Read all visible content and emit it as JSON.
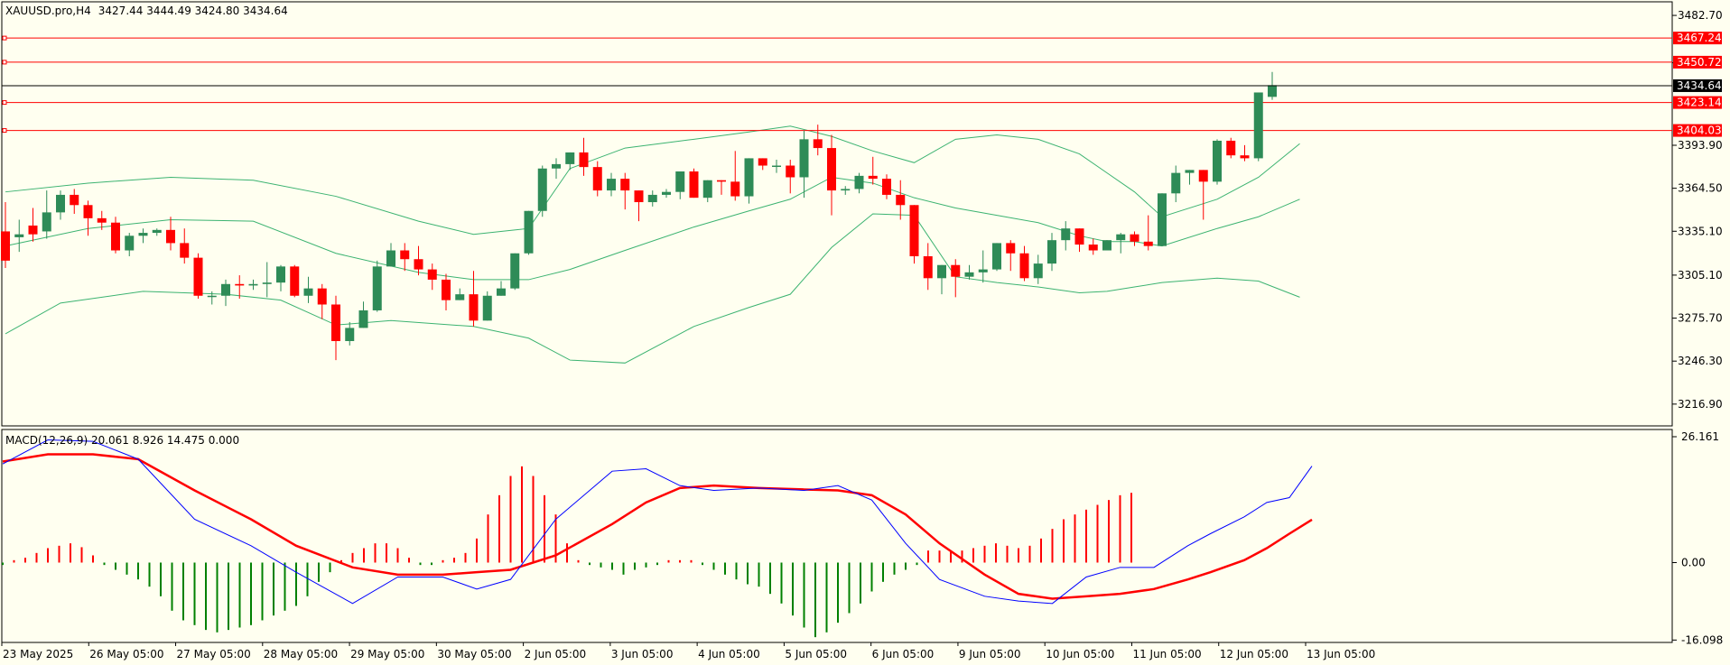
{
  "colors": {
    "background": "#fffff0",
    "bull": "#2e8b57",
    "bear": "#ff0000",
    "band": "#3cb371",
    "level": "#ff0000",
    "macd_line": "#0000ff",
    "signal_line": "#ff0000"
  },
  "chart_data": [
    {
      "type": "candlestick",
      "title": "XAUUSD.pro,H4",
      "ohlc_header": "3427.44 3444.49 3424.80 3434.64",
      "current_price": "3434.64",
      "ylim": [
        3202,
        3492
      ],
      "y_ticks": [
        "3482.70",
        "3450.30",
        "3393.90",
        "3364.50",
        "3335.10",
        "3305.10",
        "3275.70",
        "3246.30",
        "3216.90"
      ],
      "x_labels": [
        "23 May 2025",
        "26 May 05:00",
        "27 May 05:00",
        "28 May 05:00",
        "29 May 05:00",
        "30 May 05:00",
        "2 Jun 05:00",
        "3 Jun 05:00",
        "4 Jun 05:00",
        "5 Jun 05:00",
        "6 Jun 05:00",
        "9 Jun 05:00",
        "10 Jun 05:00",
        "11 Jun 05:00",
        "12 Jun 05:00",
        "13 Jun 05:00"
      ],
      "levels": [
        "3467.24",
        "3450.72",
        "3423.14",
        "3404.03"
      ],
      "candles": [
        [
          3335,
          3355,
          3315,
          3310
        ],
        [
          3331,
          3343,
          3333,
          3321
        ],
        [
          3339,
          3351,
          3333,
          3328
        ],
        [
          3335,
          3363,
          3348,
          3330
        ],
        [
          3348,
          3363,
          3360,
          3343
        ],
        [
          3360,
          3364,
          3353,
          3347
        ],
        [
          3353,
          3356,
          3344,
          3332
        ],
        [
          3344,
          3349,
          3341,
          3336
        ],
        [
          3341,
          3345,
          3322,
          3320
        ],
        [
          3322,
          3334,
          3332,
          3318
        ],
        [
          3332,
          3337,
          3334,
          3327
        ],
        [
          3334,
          3337,
          3336,
          3332
        ],
        [
          3336,
          3345,
          3327,
          3322
        ],
        [
          3327,
          3337,
          3317,
          3313
        ],
        [
          3317,
          3320,
          3291,
          3289
        ],
        [
          3291,
          3294,
          3291,
          3285
        ],
        [
          3291,
          3302,
          3299,
          3284
        ],
        [
          3299,
          3305,
          3298,
          3289
        ],
        [
          3298,
          3302,
          3299,
          3295
        ],
        [
          3299,
          3314,
          3300,
          3290
        ],
        [
          3300,
          3312,
          3311,
          3294
        ],
        [
          3311,
          3312,
          3291,
          3290
        ],
        [
          3291,
          3304,
          3296,
          3286
        ],
        [
          3296,
          3299,
          3285,
          3275
        ],
        [
          3285,
          3291,
          3260,
          3247
        ],
        [
          3260,
          3273,
          3269,
          3257
        ],
        [
          3269,
          3287,
          3281,
          3269
        ],
        [
          3281,
          3315,
          3311,
          3280
        ],
        [
          3311,
          3327,
          3322,
          3311
        ],
        [
          3322,
          3327,
          3316,
          3308
        ],
        [
          3316,
          3325,
          3309,
          3305
        ],
        [
          3309,
          3313,
          3302,
          3295
        ],
        [
          3302,
          3306,
          3288,
          3281
        ],
        [
          3288,
          3296,
          3292,
          3288
        ],
        [
          3292,
          3308,
          3274,
          3270
        ],
        [
          3274,
          3294,
          3291,
          3288
        ],
        [
          3291,
          3301,
          3296,
          3293
        ],
        [
          3296,
          3320,
          3320,
          3295
        ],
        [
          3320,
          3345,
          3349,
          3319
        ],
        [
          3349,
          3380,
          3378,
          3345
        ],
        [
          3378,
          3385,
          3381,
          3371
        ],
        [
          3381,
          3389,
          3389,
          3377
        ],
        [
          3389,
          3399,
          3379,
          3373
        ],
        [
          3379,
          3383,
          3363,
          3359
        ],
        [
          3363,
          3375,
          3371,
          3359
        ],
        [
          3371,
          3375,
          3363,
          3350
        ],
        [
          3363,
          3358,
          3355,
          3342
        ],
        [
          3355,
          3363,
          3360,
          3352
        ],
        [
          3360,
          3364,
          3362,
          3358
        ],
        [
          3362,
          3376,
          3376,
          3357
        ],
        [
          3376,
          3378,
          3358,
          3358
        ],
        [
          3358,
          3370,
          3370,
          3355
        ],
        [
          3370,
          3368,
          3369,
          3360
        ],
        [
          3369,
          3390,
          3359,
          3356
        ],
        [
          3359,
          3385,
          3385,
          3354
        ],
        [
          3385,
          3385,
          3380,
          3377
        ],
        [
          3380,
          3384,
          3380,
          3375
        ],
        [
          3380,
          3384,
          3372,
          3361
        ],
        [
          3372,
          3404,
          3398,
          3358
        ],
        [
          3398,
          3408,
          3392,
          3387
        ],
        [
          3392,
          3401,
          3363,
          3346
        ],
        [
          3363,
          3366,
          3364,
          3360
        ],
        [
          3364,
          3375,
          3373,
          3361
        ],
        [
          3373,
          3386,
          3371,
          3367
        ],
        [
          3371,
          3374,
          3360,
          3357
        ],
        [
          3360,
          3370,
          3353,
          3343
        ],
        [
          3353,
          3333,
          3318,
          3313
        ],
        [
          3318,
          3327,
          3303,
          3295
        ],
        [
          3303,
          3309,
          3312,
          3292
        ],
        [
          3312,
          3316,
          3304,
          3290
        ],
        [
          3304,
          3312,
          3307,
          3302
        ],
        [
          3307,
          3322,
          3309,
          3300
        ],
        [
          3309,
          3326,
          3327,
          3308
        ],
        [
          3327,
          3329,
          3320,
          3308
        ],
        [
          3320,
          3325,
          3303,
          3301
        ],
        [
          3303,
          3319,
          3313,
          3299
        ],
        [
          3313,
          3334,
          3329,
          3308
        ],
        [
          3329,
          3342,
          3337,
          3322
        ],
        [
          3337,
          3335,
          3326,
          3321
        ],
        [
          3326,
          3330,
          3322,
          3319
        ],
        [
          3322,
          3328,
          3329,
          3323
        ],
        [
          3329,
          3334,
          3333,
          3320
        ],
        [
          3333,
          3335,
          3328,
          3325
        ],
        [
          3328,
          3346,
          3325,
          3322
        ],
        [
          3325,
          3339,
          3361,
          3325
        ],
        [
          3361,
          3380,
          3375,
          3355
        ],
        [
          3375,
          3376,
          3377,
          3367
        ],
        [
          3377,
          3377,
          3369,
          3343
        ],
        [
          3369,
          3398,
          3397,
          3367
        ],
        [
          3397,
          3399,
          3387,
          3385
        ],
        [
          3387,
          3394,
          3385,
          3383
        ],
        [
          3385,
          3430,
          3430,
          3383
        ],
        [
          3427,
          3444,
          3435,
          3425
        ]
      ],
      "bollinger": {
        "upper": [
          [
            0,
            3362
          ],
          [
            6,
            3368
          ],
          [
            12,
            3372
          ],
          [
            18,
            3370
          ],
          [
            24,
            3359
          ],
          [
            30,
            3342
          ],
          [
            34,
            3333
          ],
          [
            38,
            3337
          ],
          [
            41,
            3378
          ],
          [
            45,
            3392
          ],
          [
            50,
            3398
          ],
          [
            54,
            3403
          ],
          [
            57,
            3407
          ],
          [
            60,
            3400
          ],
          [
            63,
            3390
          ],
          [
            66,
            3382
          ],
          [
            69,
            3398
          ],
          [
            72,
            3401
          ],
          [
            75,
            3398
          ],
          [
            78,
            3388
          ],
          [
            80,
            3375
          ],
          [
            82,
            3362
          ],
          [
            84,
            3345
          ],
          [
            88,
            3357
          ],
          [
            91,
            3372
          ],
          [
            94,
            3395
          ]
        ],
        "middle": [
          [
            0,
            3325
          ],
          [
            6,
            3337
          ],
          [
            12,
            3343
          ],
          [
            18,
            3342
          ],
          [
            24,
            3320
          ],
          [
            30,
            3307
          ],
          [
            34,
            3302
          ],
          [
            38,
            3302
          ],
          [
            41,
            3309
          ],
          [
            45,
            3322
          ],
          [
            50,
            3338
          ],
          [
            54,
            3349
          ],
          [
            57,
            3357
          ],
          [
            60,
            3372
          ],
          [
            63,
            3368
          ],
          [
            66,
            3358
          ],
          [
            69,
            3351
          ],
          [
            72,
            3346
          ],
          [
            75,
            3341
          ],
          [
            78,
            3332
          ],
          [
            80,
            3328
          ],
          [
            82,
            3328
          ],
          [
            84,
            3325
          ],
          [
            88,
            3337
          ],
          [
            91,
            3345
          ],
          [
            94,
            3357
          ]
        ],
        "lower": [
          [
            0,
            3265
          ],
          [
            4,
            3286
          ],
          [
            10,
            3294
          ],
          [
            16,
            3292
          ],
          [
            20,
            3288
          ],
          [
            24,
            3271
          ],
          [
            28,
            3274
          ],
          [
            34,
            3270
          ],
          [
            38,
            3262
          ],
          [
            41,
            3247
          ],
          [
            45,
            3245
          ],
          [
            50,
            3270
          ],
          [
            54,
            3283
          ],
          [
            57,
            3292
          ],
          [
            60,
            3324
          ],
          [
            63,
            3347
          ],
          [
            66,
            3346
          ],
          [
            69,
            3304
          ],
          [
            72,
            3300
          ],
          [
            75,
            3297
          ],
          [
            78,
            3293
          ],
          [
            80,
            3294
          ],
          [
            82,
            3297
          ],
          [
            84,
            3300
          ],
          [
            88,
            3303
          ],
          [
            91,
            3301
          ],
          [
            94,
            3290
          ]
        ]
      }
    },
    {
      "type": "macd",
      "title": "MACD(12,26,9) 20.061 8.926 14.475 0.000",
      "ylim": [
        -16.098,
        26.161
      ],
      "y_ticks": [
        "26.161",
        "0.00",
        "-16.098"
      ],
      "histogram": [
        -0.5,
        0.5,
        1.0,
        2.0,
        3.0,
        3.5,
        4.0,
        3.2,
        1.5,
        -0.5,
        -1.5,
        -2.5,
        -3.5,
        -5.0,
        -7.0,
        -10.0,
        -12.0,
        -13.0,
        -14.0,
        -14.5,
        -14.0,
        -13.5,
        -13.0,
        -12.0,
        -11.0,
        -10.0,
        -9.0,
        -7.0,
        -4.0,
        -2.0,
        0.5,
        2.0,
        3.0,
        4.0,
        4.0,
        3.0,
        1.0,
        -0.5,
        -0.5,
        0.5,
        1.0,
        2.0,
        5.0,
        10.0,
        14.0,
        18.0,
        20.0,
        18.0,
        14.0,
        10.0,
        4.0,
        0.5,
        -0.5,
        -1.0,
        -1.5,
        -2.5,
        -1.5,
        -1.0,
        -0.5,
        0.5,
        0.5,
        0.5,
        -0.5,
        -1.5,
        -2.5,
        -3.5,
        -4.5,
        -5.0,
        -6.5,
        -8.5,
        -11.0,
        -13.5,
        -15.5,
        -14.5,
        -12.5,
        -10.5,
        -8.5,
        -6.0,
        -4.0,
        -2.5,
        -1.5,
        -0.5,
        2.5,
        2.5,
        2.5,
        2.5,
        3.0,
        3.5,
        4.0,
        3.5,
        3.0,
        3.5,
        5.0,
        7.0,
        9.0,
        10.0,
        11.0,
        12.0,
        13.0,
        14.0,
        14.5
      ],
      "macd_line": [
        [
          0,
          20.5
        ],
        [
          4,
          25.5
        ],
        [
          8,
          25.2
        ],
        [
          12,
          21.5
        ],
        [
          17,
          9.0
        ],
        [
          22,
          3.5
        ],
        [
          26,
          -2.0
        ],
        [
          31,
          -8.5
        ],
        [
          35,
          -3.0
        ],
        [
          39,
          -3.0
        ],
        [
          42,
          -5.5
        ],
        [
          45,
          -3.5
        ],
        [
          49,
          9.0
        ],
        [
          54,
          19.0
        ],
        [
          57,
          19.5
        ],
        [
          60,
          16.0
        ],
        [
          63,
          15.0
        ],
        [
          67,
          15.5
        ],
        [
          71,
          15.0
        ],
        [
          74,
          16.0
        ],
        [
          77,
          13.0
        ],
        [
          80,
          4.0
        ],
        [
          83,
          -3.5
        ],
        [
          87,
          -7.0
        ],
        [
          90,
          -8.0
        ],
        [
          93,
          -8.5
        ],
        [
          96,
          -3.0
        ],
        [
          99,
          -1.0
        ],
        [
          102,
          -1.0
        ],
        [
          105,
          3.5
        ],
        [
          107,
          6.0
        ],
        [
          110,
          9.5
        ],
        [
          112,
          12.5
        ],
        [
          114,
          13.5
        ],
        [
          116,
          20.061
        ]
      ],
      "signal_line": [
        [
          0,
          21.0
        ],
        [
          4,
          22.5
        ],
        [
          8,
          22.5
        ],
        [
          12,
          21.5
        ],
        [
          17,
          15.0
        ],
        [
          22,
          9.0
        ],
        [
          26,
          3.5
        ],
        [
          31,
          -1.0
        ],
        [
          35,
          -2.5
        ],
        [
          39,
          -2.5
        ],
        [
          42,
          -2.0
        ],
        [
          45,
          -1.5
        ],
        [
          49,
          1.5
        ],
        [
          54,
          8.0
        ],
        [
          57,
          12.5
        ],
        [
          60,
          15.5
        ],
        [
          63,
          16.0
        ],
        [
          67,
          15.5
        ],
        [
          71,
          15.2
        ],
        [
          74,
          15.0
        ],
        [
          77,
          14.0
        ],
        [
          80,
          10.0
        ],
        [
          83,
          4.0
        ],
        [
          87,
          -2.5
        ],
        [
          90,
          -6.5
        ],
        [
          93,
          -7.5
        ],
        [
          96,
          -7.0
        ],
        [
          99,
          -6.5
        ],
        [
          102,
          -5.5
        ],
        [
          105,
          -3.5
        ],
        [
          107,
          -2.0
        ],
        [
          110,
          0.5
        ],
        [
          112,
          3.0
        ],
        [
          114,
          6.0
        ],
        [
          116,
          8.926
        ]
      ]
    }
  ]
}
